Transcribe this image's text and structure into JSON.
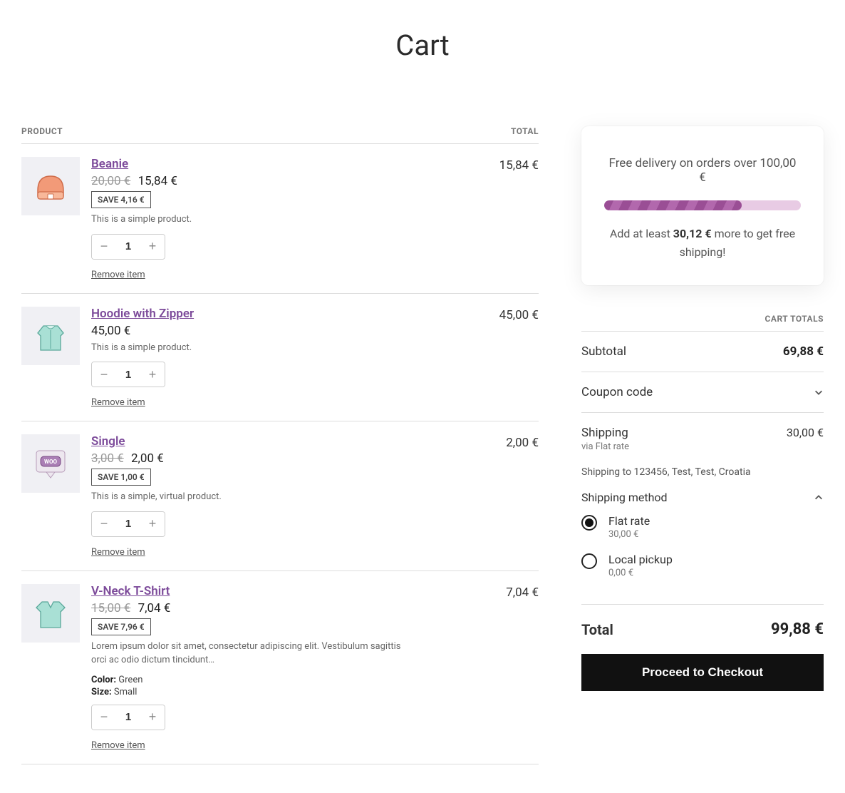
{
  "page_title": "Cart",
  "headers": {
    "product": "PRODUCT",
    "total": "TOTAL"
  },
  "items": [
    {
      "name": "Beanie",
      "old_price": "20,00 €",
      "price": "15,84 €",
      "save": "SAVE 4,16 €",
      "desc": "This is a simple product.",
      "qty": "1",
      "line_total": "15,84 €",
      "remove": "Remove item",
      "thumb": "beanie"
    },
    {
      "name": "Hoodie with Zipper",
      "old_price": "",
      "price": "45,00 €",
      "save": "",
      "desc": "This is a simple product.",
      "qty": "1",
      "line_total": "45,00 €",
      "remove": "Remove item",
      "thumb": "hoodie"
    },
    {
      "name": "Single",
      "old_price": "3,00 €",
      "price": "2,00 €",
      "save": "SAVE 1,00 €",
      "desc": "This is a simple, virtual product.",
      "qty": "1",
      "line_total": "2,00 €",
      "remove": "Remove item",
      "thumb": "single"
    },
    {
      "name": "V-Neck T-Shirt",
      "old_price": "15,00 €",
      "price": "7,04 €",
      "save": "SAVE 7,96 €",
      "desc": "Lorem ipsum dolor sit amet, consectetur adipiscing elit. Vestibulum sagittis orci ac odio dictum tincidunt…",
      "meta": {
        "color_label": "Color:",
        "color_value": "Green",
        "size_label": "Size:",
        "size_value": "Small"
      },
      "qty": "1",
      "line_total": "7,04 €",
      "remove": "Remove item",
      "thumb": "tshirt"
    }
  ],
  "free_ship": {
    "title": "Free delivery on orders over 100,00 €",
    "percent": 70,
    "note_prefix": "Add at least ",
    "note_amount": "30,12 €",
    "note_suffix": " more to get free shipping!"
  },
  "totals": {
    "heading": "CART TOTALS",
    "subtotal_label": "Subtotal",
    "subtotal_value": "69,88 €",
    "coupon_label": "Coupon code",
    "shipping_label": "Shipping",
    "shipping_value": "30,00 €",
    "shipping_via": "via Flat rate",
    "shipping_to": "Shipping to 123456, Test, Test, Croatia",
    "shipping_method_label": "Shipping method",
    "options": [
      {
        "name": "Flat rate",
        "price": "30,00 €",
        "checked": true
      },
      {
        "name": "Local pickup",
        "price": "0,00 €",
        "checked": false
      }
    ],
    "total_label": "Total",
    "total_value": "99,88 €",
    "checkout": "Proceed to Checkout"
  }
}
